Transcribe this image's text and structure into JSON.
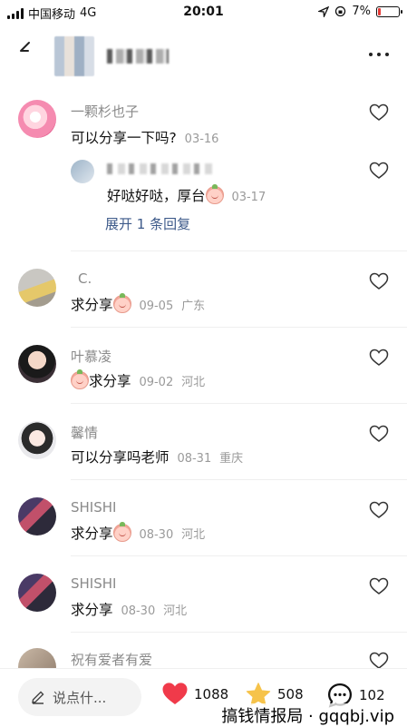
{
  "status_bar": {
    "carrier": "中国移动",
    "network": "4G",
    "time": "20:01",
    "battery": "7%"
  },
  "comments": [
    {
      "user": "一颗杉也子",
      "text": "可以分享一下吗?",
      "date": "03-16",
      "reply": {
        "text": "好哒好哒，厚台",
        "date": "03-17",
        "expand_label": "展开 1 条回复"
      }
    },
    {
      "user": "C.",
      "text": "求分享",
      "date": "09-05",
      "location": "广东"
    },
    {
      "user": "叶慕凌",
      "text": "求分享",
      "date": "09-02",
      "location": "河北"
    },
    {
      "user": "馨情",
      "text": "可以分享吗老师",
      "date": "08-31",
      "location": "重庆"
    },
    {
      "user": "SHISHI",
      "text": "求分享",
      "date": "08-30",
      "location": "河北"
    },
    {
      "user": "SHISHI",
      "text": "求分享",
      "date": "08-30",
      "location": "河北"
    },
    {
      "user": "祝有爱者有爱",
      "text": "",
      "date": "",
      "location": ""
    }
  ],
  "bottom_bar": {
    "input_placeholder": "说点什...",
    "likes": "1088",
    "favorites": "508",
    "comments": "102",
    "watermark": "搞钱情报局 · gqqbj.vip"
  },
  "colors": {
    "like_red": "#f03a4a",
    "star_yellow": "#f6c34a",
    "link_blue": "#3d5a8a"
  }
}
